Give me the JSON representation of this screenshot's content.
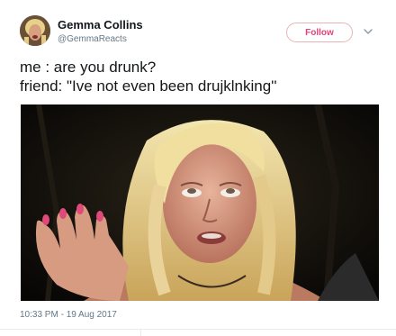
{
  "author": {
    "display_name": "Gemma Collins",
    "handle": "@GemmaReacts",
    "avatar_icon": "user-avatar"
  },
  "follow_button": {
    "label": "Follow",
    "color": "#e0245e"
  },
  "menu_icon": "chevron-down-icon",
  "tweet": {
    "lines": [
      "me : are you drunk?",
      "friend: \"Ive not even been drujklnking''"
    ]
  },
  "media": {
    "icon": "photo"
  },
  "timestamp": "10:33 PM - 19 Aug 2017"
}
